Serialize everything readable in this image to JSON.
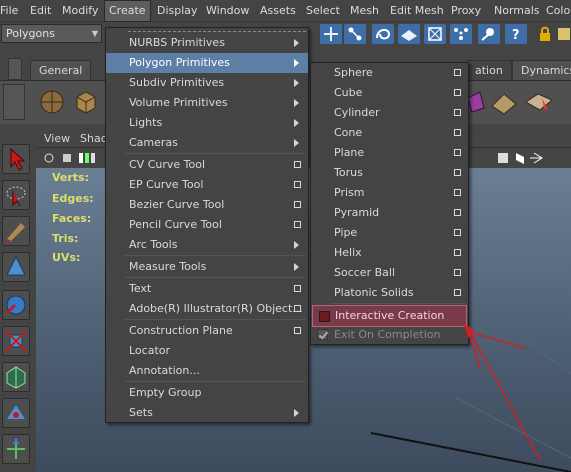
{
  "menubar": {
    "items": [
      "File",
      "Edit",
      "Modify",
      "Create",
      "Display",
      "Window",
      "Assets",
      "Select",
      "Mesh",
      "Edit Mesh",
      "Proxy",
      "Normals",
      "Color"
    ]
  },
  "status_line": {
    "mode": "Polygons"
  },
  "shelf": {
    "tabs": [
      "General",
      "ation",
      "Dynamics"
    ]
  },
  "panel": {
    "menus": [
      "View",
      "Shac"
    ]
  },
  "hud": {
    "labels": [
      "Verts:",
      "Edges:",
      "Faces:",
      "Tris:",
      "UVs:"
    ]
  },
  "create_menu": {
    "items": [
      {
        "label": "NURBS Primitives",
        "type": "submenu"
      },
      {
        "label": "Polygon Primitives",
        "type": "submenu",
        "highlighted": true
      },
      {
        "label": "Subdiv Primitives",
        "type": "submenu"
      },
      {
        "label": "Volume Primitives",
        "type": "submenu"
      },
      {
        "label": "Lights",
        "type": "submenu"
      },
      {
        "label": "Cameras",
        "type": "submenu"
      },
      {
        "label": "CV Curve Tool",
        "type": "option"
      },
      {
        "label": "EP Curve Tool",
        "type": "option"
      },
      {
        "label": "Bezier Curve Tool",
        "type": "option"
      },
      {
        "label": "Pencil Curve Tool",
        "type": "option"
      },
      {
        "label": "Arc Tools",
        "type": "submenu"
      },
      {
        "label": "Measure Tools",
        "type": "submenu"
      },
      {
        "label": "Text",
        "type": "option"
      },
      {
        "label": "Adobe(R) Illustrator(R) Object...",
        "type": "option"
      },
      {
        "label": "Construction Plane",
        "type": "option"
      },
      {
        "label": "Locator",
        "type": "plain"
      },
      {
        "label": "Annotation...",
        "type": "plain"
      },
      {
        "label": "Empty Group",
        "type": "plain"
      },
      {
        "label": "Sets",
        "type": "submenu"
      }
    ]
  },
  "polygon_menu": {
    "items": [
      "Sphere",
      "Cube",
      "Cylinder",
      "Cone",
      "Plane",
      "Torus",
      "Prism",
      "Pyramid",
      "Pipe",
      "Helix",
      "Soccer Ball",
      "Platonic Solids"
    ],
    "interactive_creation": "Interactive Creation",
    "exit_on_completion": "Exit On Completion"
  },
  "colors": {
    "highlight": "#5d7fa6",
    "interactive_bg": "#7a3a49",
    "annotation_red": "#d21f1f",
    "hud_yellow": "#dede6a"
  }
}
